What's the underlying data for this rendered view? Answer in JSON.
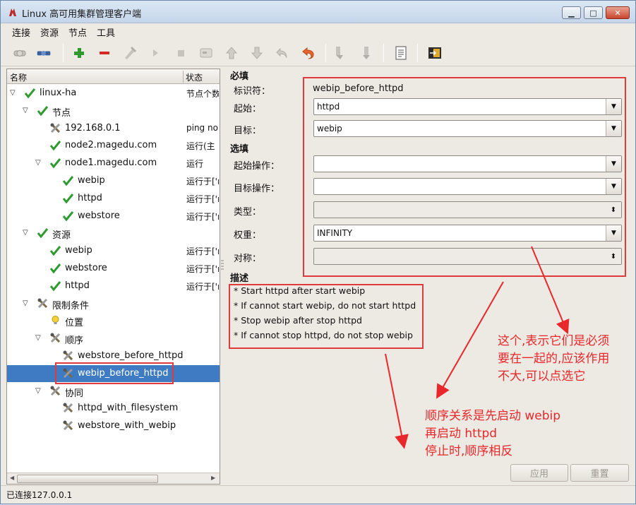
{
  "window": {
    "title": "Linux 高可用集群管理客户端",
    "min_label": "▁",
    "max_label": "□",
    "close_label": "✕"
  },
  "menu": [
    "连接",
    "资源",
    "节点",
    "工具"
  ],
  "toolbar_icons": [
    "connect-icon",
    "disconnect-icon",
    "add-icon",
    "remove-icon",
    "cleanup-icon",
    "start-icon",
    "stop-icon",
    "default-icon",
    "move-up-icon",
    "move-down-icon",
    "undo-icon",
    "redo-icon",
    "migrate-icon",
    "unmigrate-icon",
    "view-xml-icon",
    "exit-icon"
  ],
  "tree": {
    "headers": {
      "name": "名称",
      "status": "状态"
    },
    "rows": [
      {
        "label": "linux-ha",
        "status": "节点个数",
        "level": 0,
        "icon": "check"
      },
      {
        "label": "节点",
        "status": "",
        "level": 1,
        "icon": "check"
      },
      {
        "label": "192.168.0.1",
        "status": "ping no",
        "level": 2,
        "icon": "tools"
      },
      {
        "label": "node2.magedu.com",
        "status": "运行(主",
        "level": 2,
        "icon": "check"
      },
      {
        "label": "node1.magedu.com",
        "status": "运行",
        "level": 2,
        "icon": "check",
        "expanded": true
      },
      {
        "label": "webip",
        "status": "运行于['r",
        "level": 3,
        "icon": "check"
      },
      {
        "label": "httpd",
        "status": "运行于['r",
        "level": 3,
        "icon": "check"
      },
      {
        "label": "webstore",
        "status": "运行于['r",
        "level": 3,
        "icon": "check"
      },
      {
        "label": "资源",
        "status": "",
        "level": 1,
        "icon": "check"
      },
      {
        "label": "webip",
        "status": "运行于['r",
        "level": 2,
        "icon": "check"
      },
      {
        "label": "webstore",
        "status": "运行于['r",
        "level": 2,
        "icon": "check"
      },
      {
        "label": "httpd",
        "status": "运行于['r",
        "level": 2,
        "icon": "check"
      },
      {
        "label": "限制条件",
        "status": "",
        "level": 1,
        "icon": "tools"
      },
      {
        "label": "位置",
        "status": "",
        "level": 2,
        "icon": "bulb"
      },
      {
        "label": "顺序",
        "status": "",
        "level": 2,
        "icon": "tools"
      },
      {
        "label": "webstore_before_httpd",
        "status": "",
        "level": 3,
        "icon": "tools"
      },
      {
        "label": "webip_before_httpd",
        "status": "",
        "level": 3,
        "icon": "tools",
        "selected": true
      },
      {
        "label": "协同",
        "status": "",
        "level": 2,
        "icon": "tools"
      },
      {
        "label": "httpd_with_filesystem",
        "status": "",
        "level": 3,
        "icon": "tools"
      },
      {
        "label": "webstore_with_webip",
        "status": "",
        "level": 3,
        "icon": "tools"
      }
    ]
  },
  "form": {
    "required_title": "必填",
    "id_label": "标识符：",
    "id_value": "webip_before_httpd",
    "from_label": "起始：",
    "from_value": "httpd",
    "to_label": "目标：",
    "to_value": "webip",
    "optional_title": "选填",
    "from_action_label": "起始操作：",
    "from_action_value": "",
    "to_action_label": "目标操作：",
    "to_action_value": "",
    "type_label": "类型：",
    "type_value": "",
    "score_label": "权重：",
    "score_value": "INFINITY",
    "symmetric_label": "对称：",
    "symmetric_value": "",
    "desc_title": "描述",
    "desc_lines": [
      "* Start httpd after start webip",
      "* If cannot start webip, do not start httpd",
      "* Stop webip after stop httpd",
      "* If cannot stop httpd, do not stop webip"
    ],
    "apply_label": "应用",
    "reset_label": "重置"
  },
  "status": {
    "text": "已连接127.0.0.1"
  },
  "annotations": {
    "note1": [
      "这个,表示它们是必须",
      "要在一起的,应该作用",
      "不大,可以点选它"
    ],
    "note2": [
      "顺序关系是先启动 webip",
      "再启动 httpd",
      "停止时,顺序相反"
    ]
  },
  "colors": {
    "annotation": "#e8282a",
    "selection": "#3e7bc2",
    "check": "#2f9a2f"
  }
}
